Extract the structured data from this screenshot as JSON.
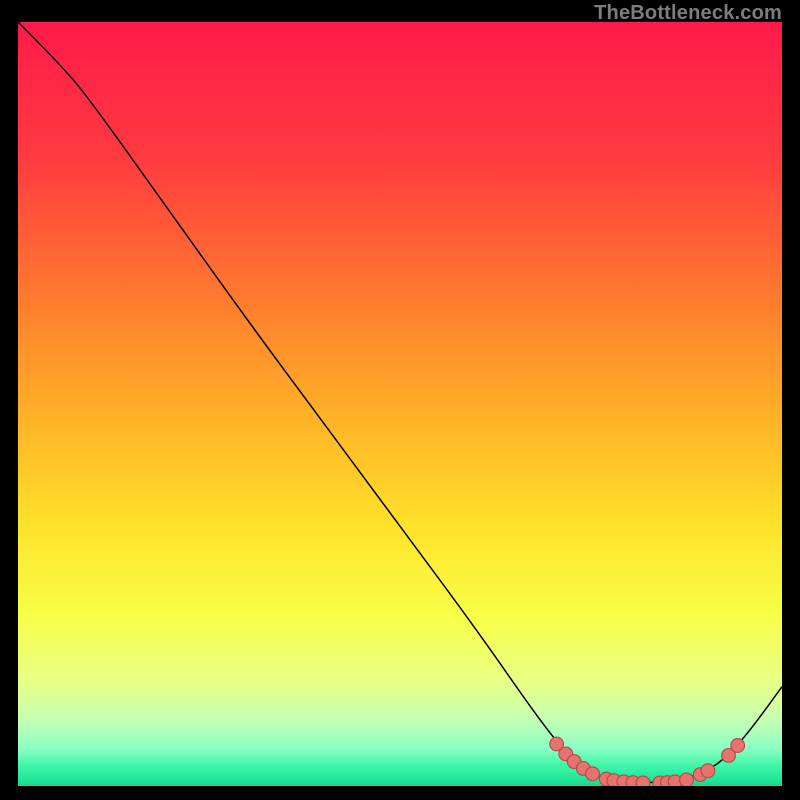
{
  "watermark": "TheBottleneck.com",
  "colors": {
    "black": "#000000",
    "curve": "#000000",
    "dot_fill": "#e8736e",
    "dot_stroke": "#b24c47"
  },
  "chart_data": {
    "type": "line",
    "title": "",
    "xlabel": "",
    "ylabel": "",
    "xlim": [
      0,
      100
    ],
    "ylim": [
      0,
      100
    ],
    "gradient_stops": [
      {
        "offset": 0.0,
        "color": "#ff1a4b"
      },
      {
        "offset": 0.18,
        "color": "#ff3b3f"
      },
      {
        "offset": 0.36,
        "color": "#ff7a2f"
      },
      {
        "offset": 0.52,
        "color": "#ffb327"
      },
      {
        "offset": 0.66,
        "color": "#ffe22a"
      },
      {
        "offset": 0.78,
        "color": "#f8ff4a"
      },
      {
        "offset": 0.86,
        "color": "#e9ff82"
      },
      {
        "offset": 0.91,
        "color": "#c9ffb0"
      },
      {
        "offset": 0.95,
        "color": "#8effc4"
      },
      {
        "offset": 0.975,
        "color": "#3bf6a8"
      },
      {
        "offset": 1.0,
        "color": "#16d98e"
      }
    ],
    "series": [
      {
        "name": "curve",
        "points": [
          {
            "x": 0,
            "y": 100
          },
          {
            "x": 6,
            "y": 94
          },
          {
            "x": 10,
            "y": 89
          },
          {
            "x": 20,
            "y": 75
          },
          {
            "x": 30,
            "y": 61
          },
          {
            "x": 40,
            "y": 47.5
          },
          {
            "x": 50,
            "y": 34
          },
          {
            "x": 60,
            "y": 20.5
          },
          {
            "x": 68,
            "y": 9
          },
          {
            "x": 72,
            "y": 4
          },
          {
            "x": 75,
            "y": 1.5
          },
          {
            "x": 78,
            "y": 0.6
          },
          {
            "x": 82,
            "y": 0.4
          },
          {
            "x": 86,
            "y": 0.6
          },
          {
            "x": 90,
            "y": 1.8
          },
          {
            "x": 93,
            "y": 4
          },
          {
            "x": 96,
            "y": 7.5
          },
          {
            "x": 100,
            "y": 13
          }
        ]
      }
    ],
    "sample_dots": [
      {
        "x": 70.5,
        "y": 5.5
      },
      {
        "x": 71.7,
        "y": 4.2
      },
      {
        "x": 72.8,
        "y": 3.2
      },
      {
        "x": 74.0,
        "y": 2.3
      },
      {
        "x": 75.2,
        "y": 1.6
      },
      {
        "x": 77.0,
        "y": 0.9
      },
      {
        "x": 78.0,
        "y": 0.7
      },
      {
        "x": 79.3,
        "y": 0.55
      },
      {
        "x": 80.5,
        "y": 0.45
      },
      {
        "x": 81.8,
        "y": 0.4
      },
      {
        "x": 84.0,
        "y": 0.4
      },
      {
        "x": 85.0,
        "y": 0.45
      },
      {
        "x": 86.0,
        "y": 0.55
      },
      {
        "x": 87.5,
        "y": 0.8
      },
      {
        "x": 89.3,
        "y": 1.5
      },
      {
        "x": 90.3,
        "y": 2.0
      },
      {
        "x": 93.0,
        "y": 4.0
      },
      {
        "x": 94.2,
        "y": 5.3
      }
    ]
  }
}
